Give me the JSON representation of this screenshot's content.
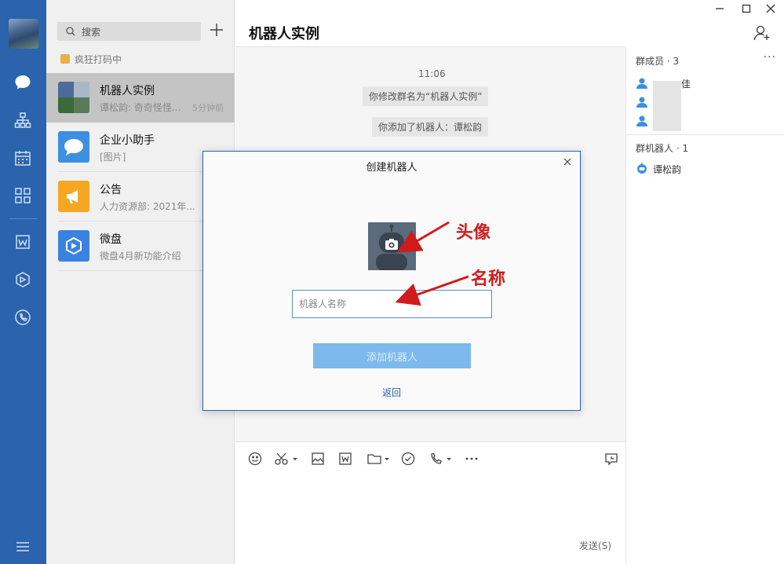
{
  "sidebar": {
    "icons": [
      "chat-icon",
      "org-chart-icon",
      "calendar-icon",
      "apps-grid-icon",
      "doc-icon",
      "drive-icon",
      "phone-icon",
      "menu-icon"
    ]
  },
  "chat_list": {
    "search_placeholder": "搜索",
    "status": "疯狂打码中",
    "items": [
      {
        "name": "机器人实例",
        "preview": "谭松韵: 奇奇怪怪...",
        "time": "5分钟前",
        "active": true
      },
      {
        "name": "企业小助手",
        "preview": "[图片]",
        "time": "",
        "active": false
      },
      {
        "name": "公告",
        "preview": "人力资源部: 2021年...",
        "time": "",
        "active": false
      },
      {
        "name": "微盘",
        "preview": "微盘4月新功能介绍",
        "time": "",
        "active": false
      }
    ]
  },
  "chat": {
    "title": "机器人实例",
    "timestamp": "11:06",
    "system_messages": [
      "你修改群名为“机器人实例”",
      "你添加了机器人：谭松韵"
    ],
    "send_label": "发送(S)"
  },
  "members": {
    "header": "群成员 · 3",
    "visible_member_fragment": "佳",
    "robots_header": "群机器人 · 1",
    "robot_name": "谭松韵"
  },
  "modal": {
    "title": "创建机器人",
    "name_placeholder": "机器人名称",
    "add_button": "添加机器人",
    "back_link": "返回"
  },
  "annotations": {
    "avatar": "头像",
    "name": "名称"
  },
  "colors": {
    "rail": "#2b63ad",
    "accent": "#2b63ad",
    "button": "#7db9ec",
    "annotation": "#d11b1b"
  }
}
